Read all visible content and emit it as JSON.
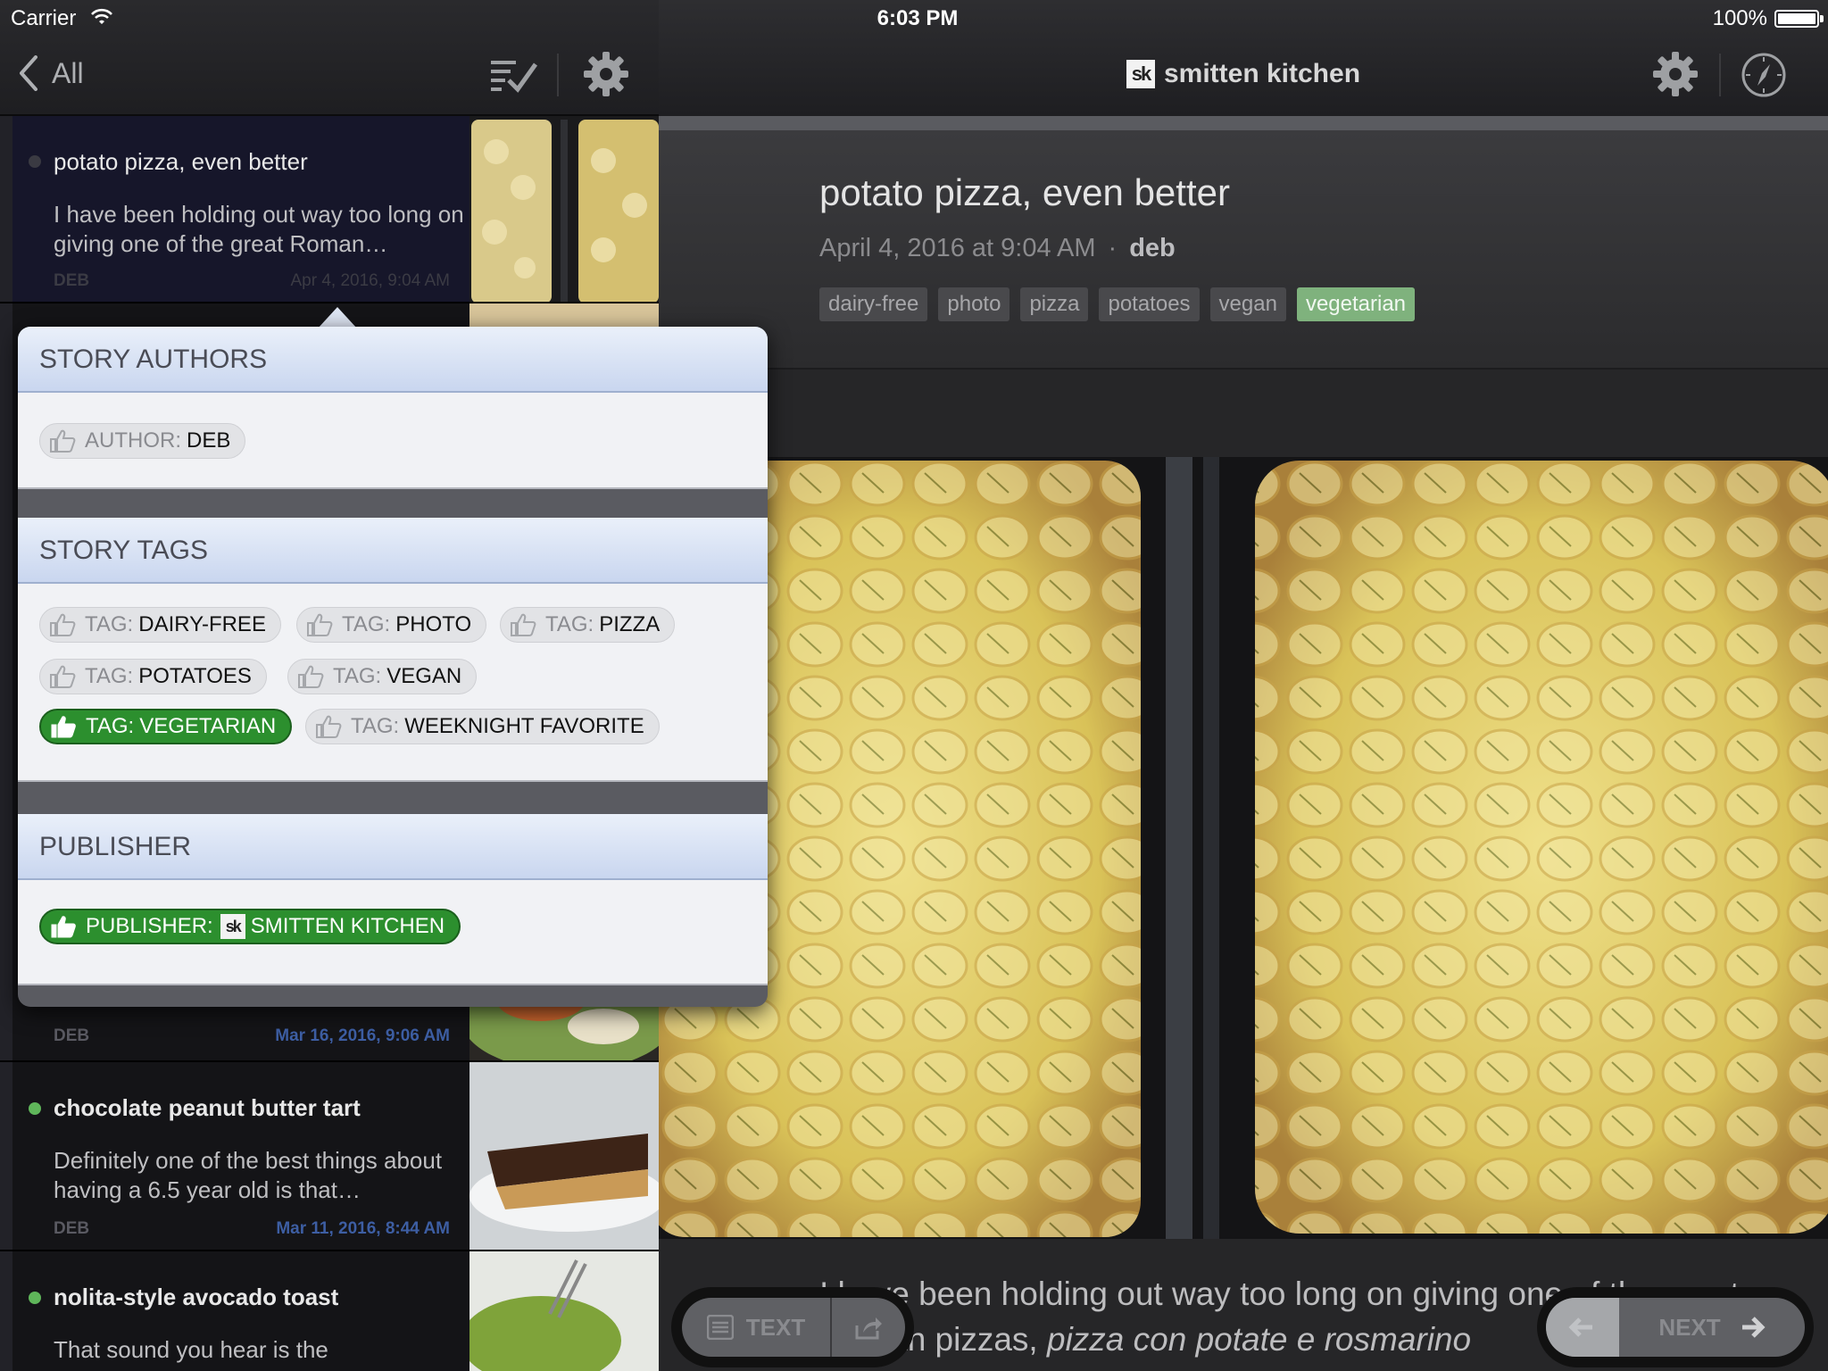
{
  "status_bar": {
    "carrier": "Carrier",
    "time": "6:03 PM",
    "battery": "100%"
  },
  "left_nav": {
    "back_label": "All"
  },
  "stories": [
    {
      "title": "potato pizza, even better",
      "snippet": "I have been holding out way too long on giving one of the great Roman…",
      "author": "DEB",
      "date": "Apr 4, 2016, 9:04 AM",
      "unread": false,
      "selected": true
    },
    {
      "title": "",
      "snippet": "",
      "author": "DEB",
      "date": "Mar 16, 2016, 9:06 AM",
      "unread": true,
      "selected": false
    },
    {
      "title": "chocolate peanut butter tart",
      "snippet": "Definitely one of the best things about having a 6.5 year old is that…",
      "author": "DEB",
      "date": "Mar 11, 2016, 8:44 AM",
      "unread": true,
      "selected": false
    },
    {
      "title": "nolita-style avocado toast",
      "snippet": "That sound you hear is the",
      "author": "",
      "date": "",
      "unread": true,
      "selected": false
    }
  ],
  "right_nav": {
    "feed_logo": "sk",
    "feed_title": "smitten kitchen"
  },
  "story": {
    "title": "potato pizza, even better",
    "date": "April 4, 2016 at 9:04 AM",
    "separator": "·",
    "author": "deb",
    "tags": [
      {
        "label": "dairy-free",
        "active": false
      },
      {
        "label": "photo",
        "active": false
      },
      {
        "label": "pizza",
        "active": false
      },
      {
        "label": "potatoes",
        "active": false
      },
      {
        "label": "vegan",
        "active": false
      },
      {
        "label": "vegetarian",
        "active": true
      }
    ],
    "body_plain": "I have been holding out way too long on giving one of the great Roman pizzas, ",
    "body_italic": "pizza con potate e rosmarino"
  },
  "bottom_controls": {
    "text_label": "TEXT",
    "next_label": "NEXT"
  },
  "popover": {
    "authors_heading": "STORY AUTHORS",
    "author_chip": {
      "kind": "AUTHOR:",
      "value": "DEB"
    },
    "tags_heading": "STORY TAGS",
    "tag_chips": [
      {
        "kind": "TAG:",
        "value": "DAIRY-FREE",
        "liked": false
      },
      {
        "kind": "TAG:",
        "value": "PHOTO",
        "liked": false
      },
      {
        "kind": "TAG:",
        "value": "PIZZA",
        "liked": false
      },
      {
        "kind": "TAG:",
        "value": "POTATOES",
        "liked": false
      },
      {
        "kind": "TAG:",
        "value": "VEGAN",
        "liked": false
      },
      {
        "kind": "TAG:",
        "value": "VEGETARIAN",
        "liked": true
      },
      {
        "kind": "TAG:",
        "value": "WEEKNIGHT FAVORITE",
        "liked": false
      }
    ],
    "publisher_heading": "PUBLISHER",
    "publisher_chip": {
      "kind": "PUBLISHER:",
      "logo": "sk",
      "value": "SMITTEN KITCHEN",
      "liked": true
    }
  },
  "colors": {
    "accent_green": "#2c8f2e",
    "active_tag": "#7fb27d",
    "unread_dot": "#5fb65a",
    "header_blue": "#c9d6ef"
  }
}
